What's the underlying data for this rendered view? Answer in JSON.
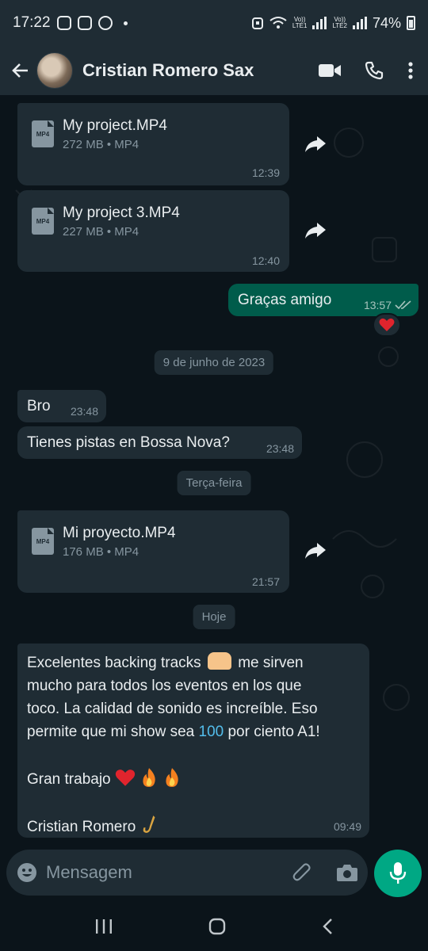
{
  "status_bar": {
    "time": "17:22",
    "battery": "74%",
    "sim1": "LTE1",
    "sim2": "LTE2",
    "volte": "Vo))"
  },
  "header": {
    "contact_name": "Cristian Romero Sax"
  },
  "messages": {
    "file1": {
      "name": "My project.MP4",
      "meta": "272 MB • MP4",
      "time": "12:39",
      "type_label": "MP4"
    },
    "file2": {
      "name": "My project 3.MP4",
      "meta": "227 MB • MP4",
      "time": "12:40",
      "type_label": "MP4"
    },
    "out1": {
      "text": "Graças amigo",
      "time": "13:57"
    },
    "date1": "9 de junho de 2023",
    "in1": {
      "text": "Bro",
      "time": "23:48"
    },
    "in2": {
      "text": "Tienes pistas en Bossa Nova?",
      "time": "23:48"
    },
    "date2": "Terça-feira",
    "file3": {
      "name": "Mi proyecto.MP4",
      "meta": "176 MB • MP4",
      "time": "21:57",
      "type_label": "MP4"
    },
    "date3": "Hoje",
    "long": {
      "line1_a": "Excelentes backing tracks",
      "line1_b": "me sirven",
      "line2": "mucho para todos los eventos  en los que",
      "line3": "toco. La calidad de sonido es increíble. Eso",
      "line4_a": "permite que mi show sea",
      "line4_num": "100",
      "line4_b": "por ciento A1!",
      "line5": "Gran trabajo",
      "line6": "Cristian Romero",
      "time": "09:49"
    }
  },
  "composer": {
    "placeholder": "Mensagem"
  },
  "colors": {
    "background": "#0b141a",
    "bubble_in": "#1f2c34",
    "bubble_out": "#005c4b",
    "accent": "#00a884",
    "link": "#53bdeb"
  }
}
